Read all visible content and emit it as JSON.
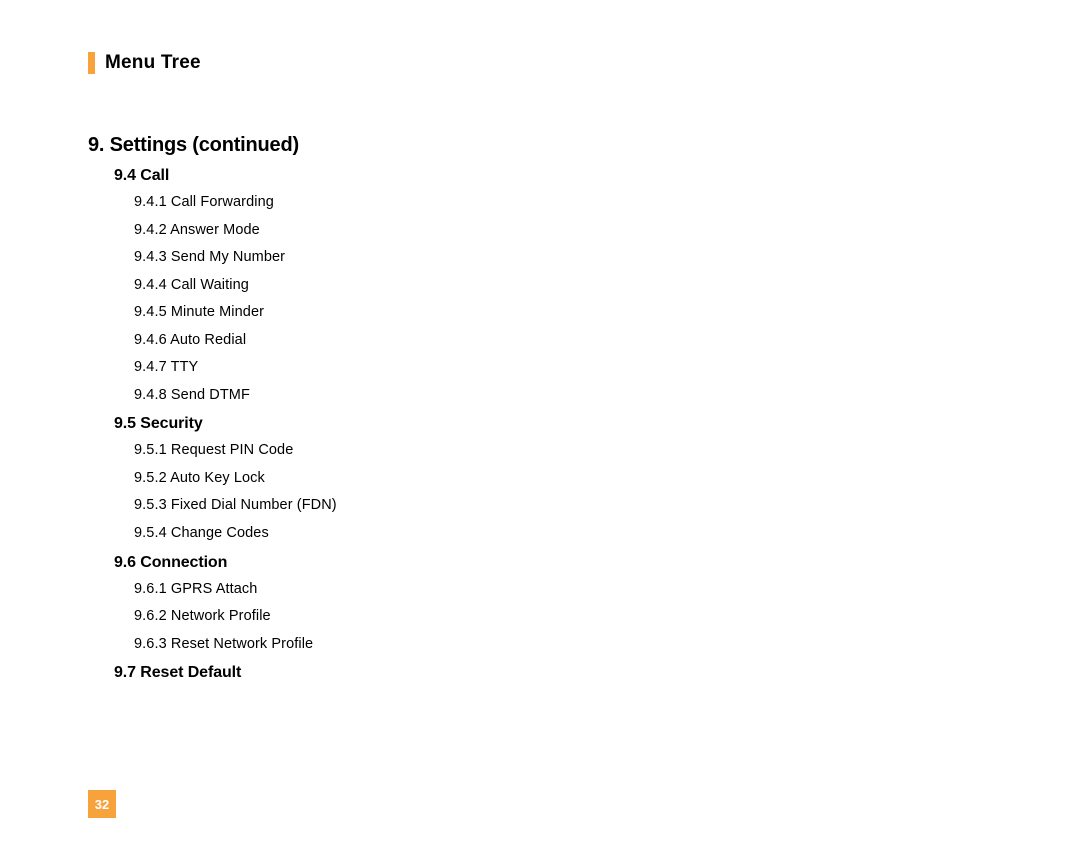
{
  "header": {
    "title": "Menu Tree"
  },
  "section": {
    "title": "9.  Settings (continued)"
  },
  "subs": [
    {
      "title": "9.4 Call",
      "items": [
        "9.4.1 Call Forwarding",
        "9.4.2 Answer Mode",
        "9.4.3 Send My Number",
        "9.4.4 Call Waiting",
        "9.4.5 Minute Minder",
        "9.4.6 Auto Redial",
        "9.4.7 TTY",
        "9.4.8 Send DTMF"
      ]
    },
    {
      "title": "9.5 Security",
      "items": [
        "9.5.1 Request PIN Code",
        "9.5.2 Auto Key Lock",
        "9.5.3 Fixed Dial Number (FDN)",
        "9.5.4 Change Codes"
      ]
    },
    {
      "title": "9.6 Connection",
      "items": [
        "9.6.1 GPRS Attach",
        "9.6.2 Network Profile",
        "9.6.3 Reset Network Profile"
      ]
    },
    {
      "title": "9.7 Reset Default",
      "items": []
    }
  ],
  "page_number": "32"
}
